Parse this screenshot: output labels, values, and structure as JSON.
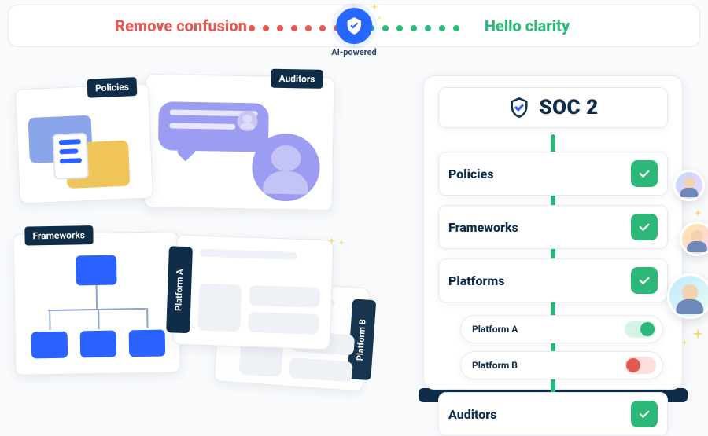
{
  "header": {
    "left_label": "Remove confusion",
    "right_label": "Hello clarity",
    "ai_label": "AI-powered"
  },
  "chaos": {
    "policies_tag": "Policies",
    "auditors_tag": "Auditors",
    "frameworks_tag": "Frameworks",
    "platform_a": "Platform A",
    "platform_b": "Platform B"
  },
  "clarity": {
    "title": "SOC 2",
    "rows": [
      {
        "label": "Policies",
        "checked": true
      },
      {
        "label": "Frameworks",
        "checked": true
      },
      {
        "label": "Platforms",
        "checked": true
      }
    ],
    "platforms": [
      {
        "label": "Platform A",
        "enabled": true
      },
      {
        "label": "Platform B",
        "enabled": false
      }
    ],
    "auditors_label": "Auditors",
    "auditors_checked": true
  },
  "icons": {
    "shield": "shield-check-icon",
    "check": "check-icon",
    "brand": "brand-mark-icon",
    "sparkle": "sparkle-icon"
  }
}
